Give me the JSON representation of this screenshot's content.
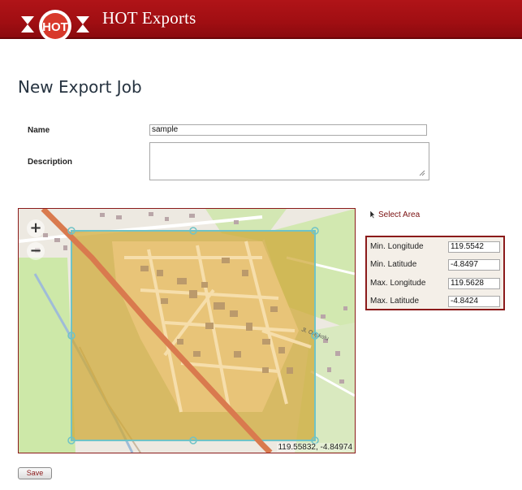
{
  "header": {
    "logo_text": "HOT",
    "app_title": "HOT Exports",
    "colors": {
      "bar": "#a00e12",
      "logo_red": "#d8392b"
    }
  },
  "page": {
    "title": "New Export Job"
  },
  "form": {
    "name_label": "Name",
    "name_value": "sample",
    "description_label": "Description",
    "description_value": ""
  },
  "map": {
    "zoom_in_label": "+",
    "zoom_out_label": "−",
    "pointer_coords": "119.55832, -4.84974",
    "street_label": "Jl. Ongkolu",
    "colors": {
      "selection_fill": "#cfaa3a",
      "selection_stroke": "#6fc3c7",
      "main_road": "#d97a4e"
    }
  },
  "selection": {
    "select_area_label": "Select Area",
    "rows": [
      {
        "label": "Min. Longitude",
        "value": "119.5542"
      },
      {
        "label": "Min. Latitude",
        "value": "-4.8497"
      },
      {
        "label": "Max. Longitude",
        "value": "119.5628"
      },
      {
        "label": "Max. Latitude",
        "value": "-4.8424"
      }
    ]
  },
  "actions": {
    "save_label": "Save"
  }
}
